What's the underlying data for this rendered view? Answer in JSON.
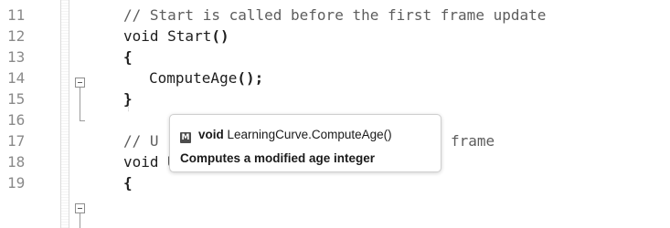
{
  "editor": {
    "lines": [
      {
        "number": "11",
        "text": "// Start is called before the first frame update"
      },
      {
        "number": "12",
        "text": "void Start()"
      },
      {
        "number": "13",
        "text": "{"
      },
      {
        "number": "14",
        "text": "ComputeAge();"
      },
      {
        "number": "15",
        "text": "}"
      },
      {
        "number": "16",
        "text": ""
      },
      {
        "number": "17",
        "text_visible_left": "// U",
        "text_visible_right": "frame"
      },
      {
        "number": "18",
        "text": "void Update()"
      },
      {
        "number": "19",
        "text": "{"
      }
    ]
  },
  "tooltip": {
    "icon_letter": "M",
    "return_type": "void",
    "signature": "LearningCurve.ComputeAge()",
    "description": "Computes a modified age integer"
  }
}
